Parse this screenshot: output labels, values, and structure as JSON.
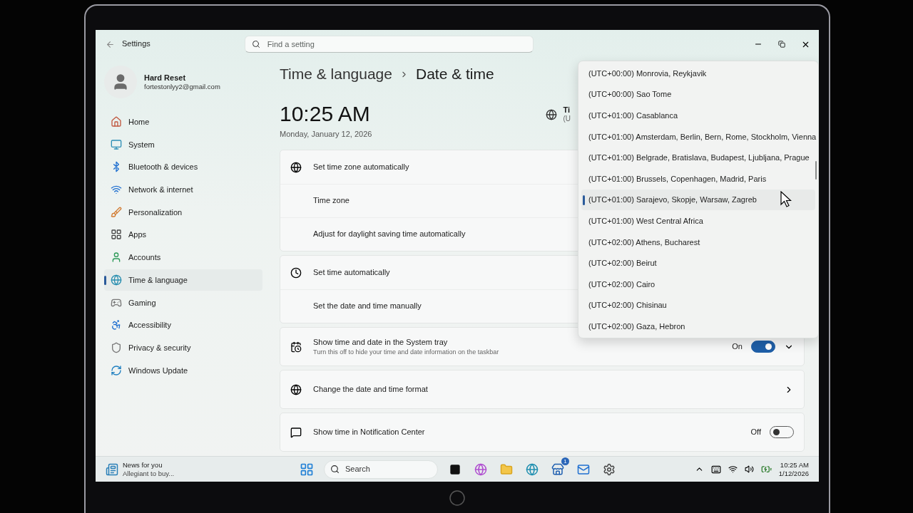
{
  "window": {
    "title": "Settings",
    "search_placeholder": "Find a setting"
  },
  "profile": {
    "name": "Hard Reset",
    "email": "fortestonlyy2@gmail.com"
  },
  "sidebar": {
    "items": [
      {
        "label": "Home",
        "selected": false
      },
      {
        "label": "System",
        "selected": false
      },
      {
        "label": "Bluetooth & devices",
        "selected": false
      },
      {
        "label": "Network & internet",
        "selected": false
      },
      {
        "label": "Personalization",
        "selected": false
      },
      {
        "label": "Apps",
        "selected": false
      },
      {
        "label": "Accounts",
        "selected": false
      },
      {
        "label": "Time & language",
        "selected": true
      },
      {
        "label": "Gaming",
        "selected": false
      },
      {
        "label": "Accessibility",
        "selected": false
      },
      {
        "label": "Privacy & security",
        "selected": false
      },
      {
        "label": "Windows Update",
        "selected": false
      }
    ]
  },
  "breadcrumb": {
    "parent": "Time & language",
    "current": "Date & time"
  },
  "clock": {
    "time": "10:25 AM",
    "date": "Monday, January 12, 2026"
  },
  "timezone_summary": {
    "title": "Ti",
    "value": "(U"
  },
  "setting_groups": [
    {
      "rows": [
        {
          "label": "Set time zone automatically",
          "kind": "plain"
        },
        {
          "label": "Time zone",
          "kind": "plain"
        },
        {
          "label": "Adjust for daylight saving time automatically",
          "kind": "plain"
        }
      ]
    },
    {
      "rows": [
        {
          "label": "Set time automatically",
          "kind": "plain"
        },
        {
          "label": "Set the date and time manually",
          "kind": "plain"
        }
      ]
    },
    {
      "rows": [
        {
          "label": "Show time and date in the System tray",
          "description": "Turn this off to hide your time and date information on the taskbar",
          "kind": "toggle_expand",
          "on": true,
          "state_label": "On"
        }
      ]
    },
    {
      "rows": [
        {
          "label": "Change the date and time format",
          "kind": "link"
        }
      ]
    },
    {
      "rows": [
        {
          "label": "Show time in Notification Center",
          "kind": "toggle",
          "on": false,
          "state_label": "Off"
        }
      ]
    }
  ],
  "timezone_dropdown": {
    "items": [
      {
        "label": "(UTC+00:00) Monrovia, Reykjavik",
        "selected": false
      },
      {
        "label": "(UTC+00:00) Sao Tome",
        "selected": false
      },
      {
        "label": "(UTC+01:00) Casablanca",
        "selected": false
      },
      {
        "label": "(UTC+01:00) Amsterdam, Berlin, Bern, Rome, Stockholm, Vienna",
        "selected": false
      },
      {
        "label": "(UTC+01:00) Belgrade, Bratislava, Budapest, Ljubljana, Prague",
        "selected": false
      },
      {
        "label": "(UTC+01:00) Brussels, Copenhagen, Madrid, Paris",
        "selected": false
      },
      {
        "label": "(UTC+01:00) Sarajevo, Skopje, Warsaw, Zagreb",
        "selected": true
      },
      {
        "label": "(UTC+01:00) West Central Africa",
        "selected": false
      },
      {
        "label": "(UTC+02:00) Athens, Bucharest",
        "selected": false
      },
      {
        "label": "(UTC+02:00) Beirut",
        "selected": false
      },
      {
        "label": "(UTC+02:00) Cairo",
        "selected": false
      },
      {
        "label": "(UTC+02:00) Chisinau",
        "selected": false
      },
      {
        "label": "(UTC+02:00) Gaza, Hebron",
        "selected": false
      }
    ]
  },
  "taskbar": {
    "widget_title": "News for you",
    "widget_subtitle": "Allegiant to buy...",
    "search_label": "Search",
    "store_badge": "1",
    "time": "10:25 AM",
    "date": "1/12/2026"
  }
}
